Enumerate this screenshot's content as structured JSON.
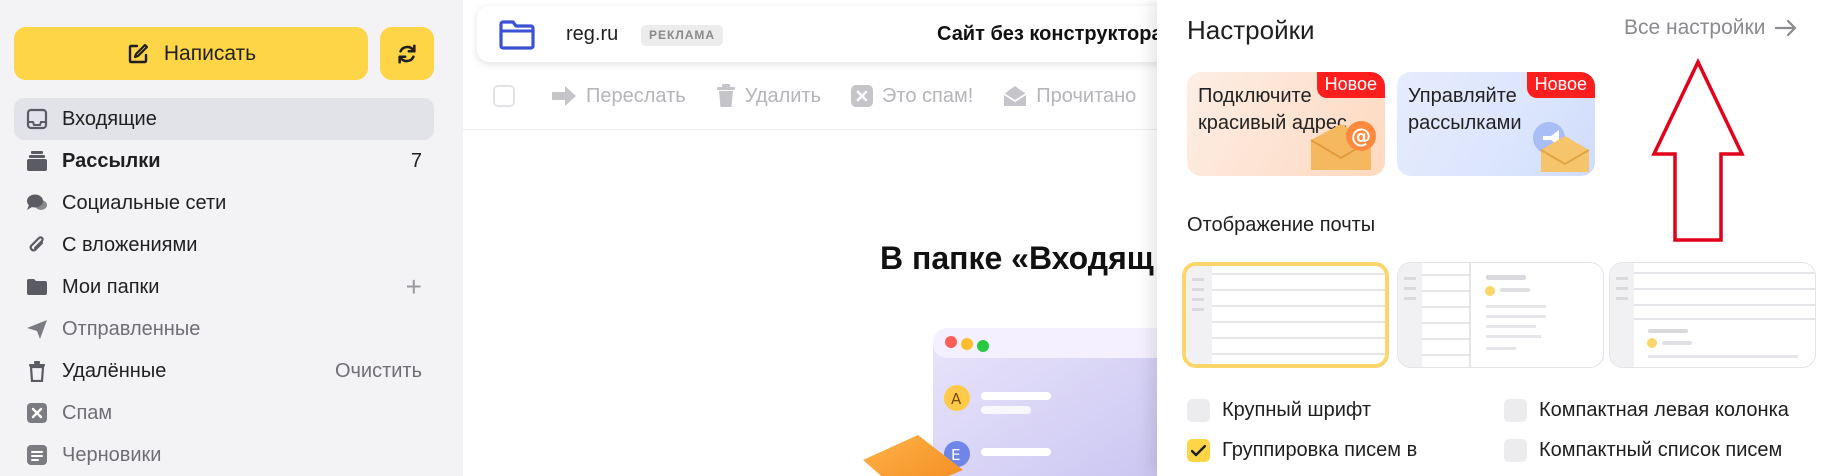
{
  "sidebar": {
    "compose_label": "Написать",
    "folders": [
      {
        "label": "Входящие",
        "icon": "inbox-icon",
        "right": ""
      },
      {
        "label": "Рассылки",
        "icon": "newsletters-icon",
        "right": "7"
      },
      {
        "label": "Социальные сети",
        "icon": "social-icon",
        "right": ""
      },
      {
        "label": "С вложениями",
        "icon": "paperclip-icon",
        "right": ""
      },
      {
        "label": "Мои папки",
        "icon": "folder-icon",
        "right": "+"
      },
      {
        "label": "Отправленные",
        "icon": "sent-icon",
        "right": ""
      },
      {
        "label": "Удалённые",
        "icon": "trash-icon",
        "right": "Очистить"
      },
      {
        "label": "Спам",
        "icon": "spam-icon",
        "right": ""
      },
      {
        "label": "Черновики",
        "icon": "drafts-icon",
        "right": ""
      }
    ]
  },
  "ad": {
    "domain": "reg.ru",
    "badge": "РЕКЛАМА",
    "text": "Сайт без конструктора за"
  },
  "toolbar": {
    "forward": "Переслать",
    "delete": "Удалить",
    "spam": "Это спам!",
    "read": "Прочитано"
  },
  "main": {
    "empty_title": "В папке «Входящ"
  },
  "settings": {
    "title": "Настройки",
    "all_settings": "Все настройки",
    "promo1": "Подключите красивый адрес",
    "promo2": "Управляйте рассылками",
    "new_badge": "Новое",
    "display_title": "Отображение почты",
    "options": {
      "large_font": "Крупный шрифт",
      "compact_left": "Компактная левая колонка",
      "grouping": "Группировка писем в",
      "compact_list": "Компактный список писем"
    },
    "checked": {
      "large_font": false,
      "compact_left": false,
      "grouping": true,
      "compact_list": false
    }
  },
  "colors": {
    "accent": "#fed546",
    "new_badge": "#ff1e1e",
    "annotation_arrow": "#e3001b"
  }
}
